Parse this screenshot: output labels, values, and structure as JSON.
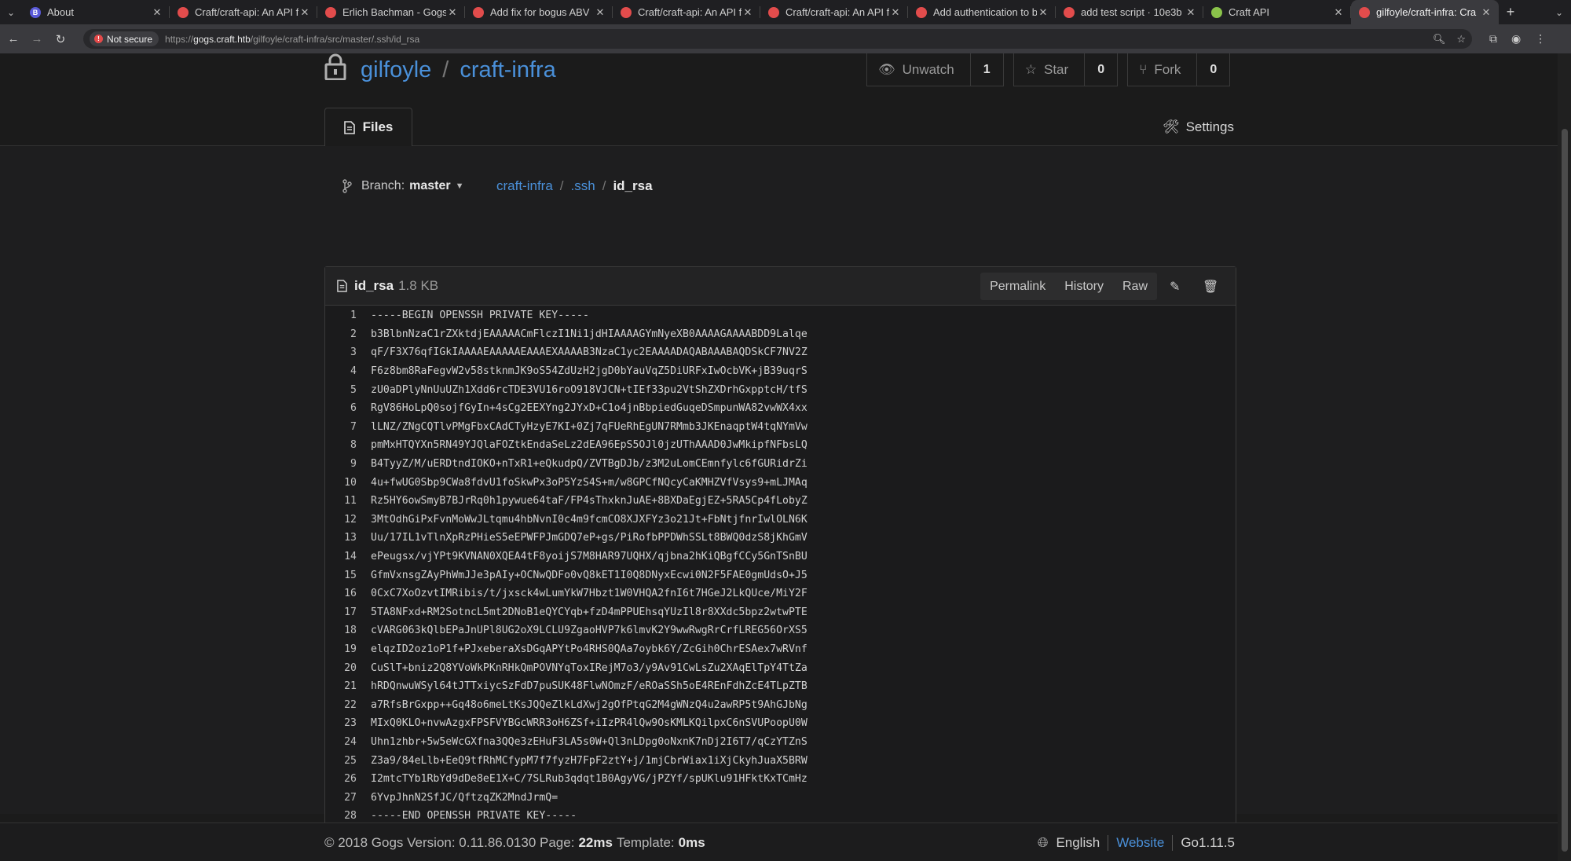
{
  "browser": {
    "tabs": [
      {
        "title": "About",
        "icon": "b"
      },
      {
        "title": "Craft/craft-api: An API f",
        "icon": "gogs"
      },
      {
        "title": "Erlich Bachman - Gogs",
        "icon": "gogs"
      },
      {
        "title": "Add fix for bogus ABV",
        "icon": "gogs"
      },
      {
        "title": "Craft/craft-api: An API f",
        "icon": "gogs"
      },
      {
        "title": "Craft/craft-api: An API f",
        "icon": "gogs"
      },
      {
        "title": "Add authentication to b",
        "icon": "gogs"
      },
      {
        "title": "add test script · 10e3b",
        "icon": "gogs"
      },
      {
        "title": "Craft API",
        "icon": "g"
      },
      {
        "title": "gilfoyle/craft-infra: Cra",
        "icon": "gogs",
        "active": true
      }
    ],
    "security_label": "Not secure",
    "url_scheme": "https://",
    "url_host": "gogs.craft.htb",
    "url_path": "/gilfoyle/craft-infra/src/master/.ssh/id_rsa"
  },
  "repo": {
    "owner": "gilfoyle",
    "name": "craft-infra",
    "watch_label": "Unwatch",
    "watch_count": "1",
    "star_label": "Star",
    "star_count": "0",
    "fork_label": "Fork",
    "fork_count": "0",
    "files_tab": "Files",
    "settings_tab": "Settings"
  },
  "branch": {
    "label": "Branch:",
    "name": "master"
  },
  "breadcrumb": {
    "root": "craft-infra",
    "dir": ".ssh",
    "file": "id_rsa"
  },
  "file": {
    "name": "id_rsa",
    "size": "1.8 KB",
    "permalink": "Permalink",
    "history": "History",
    "raw": "Raw",
    "lines": [
      "-----BEGIN OPENSSH PRIVATE KEY-----",
      "b3BlbnNzaC1rZXktdjEAAAAACmFlczI1Ni1jdHIAAAAGYmNyeXB0AAAAGAAAABDD9Lalqe",
      "qF/F3X76qfIGkIAAAAEAAAAAEAAAEXAAAAB3NzaC1yc2EAAAADAQABAAABAQDSkCF7NV2Z",
      "F6z8bm8RaFegvW2v58stknmJK9oS54ZdUzH2jgD0bYauVqZ5DiURFxIwOcbVK+jB39uqrS",
      "zU0aDPlyNnUuUZh1Xdd6rcTDE3VU16roO918VJCN+tIEf33pu2VtShZXDrhGxpptcH/tfS",
      "RgV86HoLpQ0sojfGyIn+4sCg2EEXYng2JYxD+C1o4jnBbpiedGuqeDSmpunWA82vwWX4xx",
      "lLNZ/ZNgCQTlvPMgFbxCAdCTyHzyE7KI+0Zj7qFUeRhEgUN7RMmb3JKEnaqptW4tqNYmVw",
      "pmMxHTQYXn5RN49YJQlaFOZtkEndaSeLz2dEA96EpS5OJl0jzUThAAAD0JwMkipfNFbsLQ",
      "B4TyyZ/M/uERDtndIOKO+nTxR1+eQkudpQ/ZVTBgDJb/z3M2uLomCEmnfylc6fGURidrZi",
      "4u+fwUG0Sbp9CWa8fdvU1foSkwPx3oP5YzS4S+m/w8GPCfNQcyCaKMHZVfVsys9+mLJMAq",
      "Rz5HY6owSmyB7BJrRq0h1pywue64taF/FP4sThxknJuAE+8BXDaEgjEZ+5RA5Cp4fLobyZ",
      "3MtOdhGiPxFvnMoWwJLtqmu4hbNvnI0c4m9fcmCO8XJXFYz3o21Jt+FbNtjfnrIwlOLN6K",
      "Uu/17IL1vTlnXpRzPHieS5eEPWFPJmGDQ7eP+gs/PiRofbPPDWhSSLt8BWQ0dzS8jKhGmV",
      "ePeugsx/vjYPt9KVNAN0XQEA4tF8yoijS7M8HAR97UQHX/qjbna2hKiQBgfCCy5GnTSnBU",
      "GfmVxnsgZAyPhWmJJe3pAIy+OCNwQDFo0vQ8kET1I0Q8DNyxEcwi0N2F5FAE0gmUdsO+J5",
      "0CxC7XoOzvtIMRibis/t/jxsck4wLumYkW7Hbzt1W0VHQA2fnI6t7HGeJ2LkQUce/MiY2F",
      "5TA8NFxd+RM2SotncL5mt2DNoB1eQYCYqb+fzD4mPPUEhsqYUzIl8r8XXdc5bpz2wtwPTE",
      "cVARG063kQlbEPaJnUPl8UG2oX9LCLU9ZgaoHVP7k6lmvK2Y9wwRwgRrCrfLREG56OrXS5",
      "elqzID2oz1oP1f+PJxeberaXsDGqAPYtPo4RHS0QAa7oybk6Y/ZcGih0ChrESAex7wRVnf",
      "CuSlT+bniz2Q8YVoWkPKnRHkQmPOVNYqToxIRejM7o3/y9Av91CwLsZu2XAqElTpY4TtZa",
      "hRDQnwuWSyl64tJTTxiycSzFdD7puSUK48FlwNOmzF/eROaSSh5oE4REnFdhZcE4TLpZTB",
      "a7RfsBrGxpp++Gq48o6meLtKsJQQeZlkLdXwj2gOfPtqG2M4gWNzQ4u2awRP5t9AhGJbNg",
      "MIxQ0KLO+nvwAzgxFPSFVYBGcWRR3oH6ZSf+iIzPR4lQw9OsKMLKQilpxC6nSVUPoopU0W",
      "Uhn1zhbr+5w5eWcGXfna3QQe3zEHuF3LA5s0W+Ql3nLDpg0oNxnK7nDj2I6T7/qCzYTZnS",
      "Z3a9/84eLlb+EeQ9tfRhMCfypM7f7fyzH7FpF2ztY+j/1mjCbrWiax1iXjCkyhJuaX5BRW",
      "I2mtcTYb1RbYd9dDe8eE1X+C/7SLRub3qdqt1B0AgyVG/jPZYf/spUKlu91HFktKxTCmHz",
      "6YvpJhnN2SfJC/QftzqZK2MndJrmQ=",
      "-----END OPENSSH PRIVATE KEY-----"
    ]
  },
  "footer": {
    "copyright": "© 2018 Gogs Version: 0.11.86.0130 Page:",
    "page_time": "22ms",
    "template_label": "Template:",
    "template_time": "0ms",
    "language": "English",
    "website": "Website",
    "go_version": "Go1.11.5"
  }
}
